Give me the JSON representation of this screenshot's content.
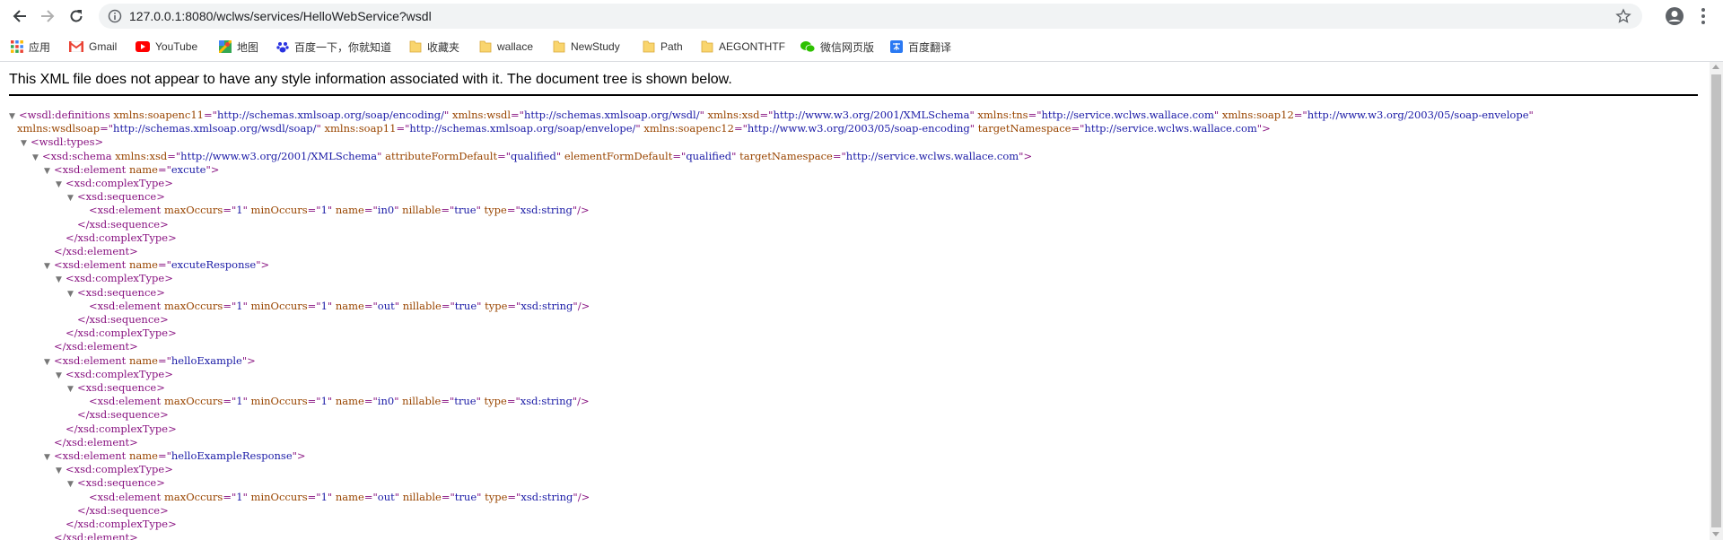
{
  "browser": {
    "url": "127.0.0.1:8080/wclws/services/HelloWebService?wsdl",
    "bookmarks": [
      {
        "label": "应用",
        "icon": "apps-grid-icon"
      },
      {
        "label": "Gmail",
        "icon": "gmail-icon"
      },
      {
        "label": "YouTube",
        "icon": "youtube-icon"
      },
      {
        "label": "地图",
        "icon": "maps-icon"
      },
      {
        "label": "百度一下，你就知道",
        "icon": "baidu-icon"
      },
      {
        "label": "收藏夹",
        "icon": "folder-icon"
      },
      {
        "label": "wallace",
        "icon": "folder-icon"
      },
      {
        "label": "NewStudy",
        "icon": "folder-icon"
      },
      {
        "label": "Path",
        "icon": "folder-icon"
      },
      {
        "label": "AEGONTHTF",
        "icon": "folder-icon"
      },
      {
        "label": "微信网页版",
        "icon": "wechat-icon"
      },
      {
        "label": "百度翻译",
        "icon": "baidu-translate-icon"
      }
    ]
  },
  "notice": "This XML file does not appear to have any style information associated with it. The document tree is shown below.",
  "xml_lines": [
    {
      "indent": 0,
      "toggle": true,
      "parts": [
        [
          "t",
          "<wsdl:definitions "
        ],
        [
          "n",
          "xmlns:soapenc11"
        ],
        [
          "t",
          "=\""
        ],
        [
          "v",
          "http://schemas.xmlsoap.org/soap/encoding/"
        ],
        [
          "t",
          "\" "
        ],
        [
          "n",
          "xmlns:wsdl"
        ],
        [
          "t",
          "=\""
        ],
        [
          "v",
          "http://schemas.xmlsoap.org/wsdl/"
        ],
        [
          "t",
          "\" "
        ],
        [
          "n",
          "xmlns:xsd"
        ],
        [
          "t",
          "=\""
        ],
        [
          "v",
          "http://www.w3.org/2001/XMLSchema"
        ],
        [
          "t",
          "\" "
        ],
        [
          "n",
          "xmlns:tns"
        ],
        [
          "t",
          "=\""
        ],
        [
          "v",
          "http://service.wclws.wallace.com"
        ],
        [
          "t",
          "\" "
        ],
        [
          "n",
          "xmlns:soap12"
        ],
        [
          "t",
          "=\""
        ],
        [
          "v",
          "http://www.w3.org/2003/05/soap-envelope"
        ],
        [
          "t",
          "\""
        ]
      ]
    },
    {
      "indent": 0,
      "toggle": false,
      "cont": true,
      "parts": [
        [
          "n",
          "xmlns:wsdlsoap"
        ],
        [
          "t",
          "=\""
        ],
        [
          "v",
          "http://schemas.xmlsoap.org/wsdl/soap/"
        ],
        [
          "t",
          "\" "
        ],
        [
          "n",
          "xmlns:soap11"
        ],
        [
          "t",
          "=\""
        ],
        [
          "v",
          "http://schemas.xmlsoap.org/soap/envelope/"
        ],
        [
          "t",
          "\" "
        ],
        [
          "n",
          "xmlns:soapenc12"
        ],
        [
          "t",
          "=\""
        ],
        [
          "v",
          "http://www.w3.org/2003/05/soap-encoding"
        ],
        [
          "t",
          "\" "
        ],
        [
          "n",
          "targetNamespace"
        ],
        [
          "t",
          "=\""
        ],
        [
          "v",
          "http://service.wclws.wallace.com"
        ],
        [
          "t",
          "\">"
        ]
      ]
    },
    {
      "indent": 1,
      "toggle": true,
      "parts": [
        [
          "t",
          "<wsdl:types>"
        ]
      ]
    },
    {
      "indent": 2,
      "toggle": true,
      "parts": [
        [
          "t",
          "<xsd:schema "
        ],
        [
          "n",
          "xmlns:xsd"
        ],
        [
          "t",
          "=\""
        ],
        [
          "v",
          "http://www.w3.org/2001/XMLSchema"
        ],
        [
          "t",
          "\" "
        ],
        [
          "n",
          "attributeFormDefault"
        ],
        [
          "t",
          "=\""
        ],
        [
          "v",
          "qualified"
        ],
        [
          "t",
          "\" "
        ],
        [
          "n",
          "elementFormDefault"
        ],
        [
          "t",
          "=\""
        ],
        [
          "v",
          "qualified"
        ],
        [
          "t",
          "\" "
        ],
        [
          "n",
          "targetNamespace"
        ],
        [
          "t",
          "=\""
        ],
        [
          "v",
          "http://service.wclws.wallace.com"
        ],
        [
          "t",
          "\">"
        ]
      ]
    },
    {
      "indent": 3,
      "toggle": true,
      "parts": [
        [
          "t",
          "<xsd:element "
        ],
        [
          "n",
          "name"
        ],
        [
          "t",
          "=\""
        ],
        [
          "v",
          "excute"
        ],
        [
          "t",
          "\">"
        ]
      ]
    },
    {
      "indent": 4,
      "toggle": true,
      "parts": [
        [
          "t",
          "<xsd:complexType>"
        ]
      ]
    },
    {
      "indent": 5,
      "toggle": true,
      "parts": [
        [
          "t",
          "<xsd:sequence>"
        ]
      ]
    },
    {
      "indent": 6,
      "toggle": false,
      "parts": [
        [
          "t",
          "<xsd:element "
        ],
        [
          "n",
          "maxOccurs"
        ],
        [
          "t",
          "=\""
        ],
        [
          "v",
          "1"
        ],
        [
          "t",
          "\" "
        ],
        [
          "n",
          "minOccurs"
        ],
        [
          "t",
          "=\""
        ],
        [
          "v",
          "1"
        ],
        [
          "t",
          "\" "
        ],
        [
          "n",
          "name"
        ],
        [
          "t",
          "=\""
        ],
        [
          "v",
          "in0"
        ],
        [
          "t",
          "\" "
        ],
        [
          "n",
          "nillable"
        ],
        [
          "t",
          "=\""
        ],
        [
          "v",
          "true"
        ],
        [
          "t",
          "\" "
        ],
        [
          "n",
          "type"
        ],
        [
          "t",
          "=\""
        ],
        [
          "v",
          "xsd:string"
        ],
        [
          "t",
          "\"/>"
        ]
      ]
    },
    {
      "indent": 5,
      "toggle": false,
      "parts": [
        [
          "t",
          "</xsd:sequence>"
        ]
      ]
    },
    {
      "indent": 4,
      "toggle": false,
      "parts": [
        [
          "t",
          "</xsd:complexType>"
        ]
      ]
    },
    {
      "indent": 3,
      "toggle": false,
      "parts": [
        [
          "t",
          "</xsd:element>"
        ]
      ]
    },
    {
      "indent": 3,
      "toggle": true,
      "parts": [
        [
          "t",
          "<xsd:element "
        ],
        [
          "n",
          "name"
        ],
        [
          "t",
          "=\""
        ],
        [
          "v",
          "excuteResponse"
        ],
        [
          "t",
          "\">"
        ]
      ]
    },
    {
      "indent": 4,
      "toggle": true,
      "parts": [
        [
          "t",
          "<xsd:complexType>"
        ]
      ]
    },
    {
      "indent": 5,
      "toggle": true,
      "parts": [
        [
          "t",
          "<xsd:sequence>"
        ]
      ]
    },
    {
      "indent": 6,
      "toggle": false,
      "parts": [
        [
          "t",
          "<xsd:element "
        ],
        [
          "n",
          "maxOccurs"
        ],
        [
          "t",
          "=\""
        ],
        [
          "v",
          "1"
        ],
        [
          "t",
          "\" "
        ],
        [
          "n",
          "minOccurs"
        ],
        [
          "t",
          "=\""
        ],
        [
          "v",
          "1"
        ],
        [
          "t",
          "\" "
        ],
        [
          "n",
          "name"
        ],
        [
          "t",
          "=\""
        ],
        [
          "v",
          "out"
        ],
        [
          "t",
          "\" "
        ],
        [
          "n",
          "nillable"
        ],
        [
          "t",
          "=\""
        ],
        [
          "v",
          "true"
        ],
        [
          "t",
          "\" "
        ],
        [
          "n",
          "type"
        ],
        [
          "t",
          "=\""
        ],
        [
          "v",
          "xsd:string"
        ],
        [
          "t",
          "\"/>"
        ]
      ]
    },
    {
      "indent": 5,
      "toggle": false,
      "parts": [
        [
          "t",
          "</xsd:sequence>"
        ]
      ]
    },
    {
      "indent": 4,
      "toggle": false,
      "parts": [
        [
          "t",
          "</xsd:complexType>"
        ]
      ]
    },
    {
      "indent": 3,
      "toggle": false,
      "parts": [
        [
          "t",
          "</xsd:element>"
        ]
      ]
    },
    {
      "indent": 3,
      "toggle": true,
      "parts": [
        [
          "t",
          "<xsd:element "
        ],
        [
          "n",
          "name"
        ],
        [
          "t",
          "=\""
        ],
        [
          "v",
          "helloExample"
        ],
        [
          "t",
          "\">"
        ]
      ]
    },
    {
      "indent": 4,
      "toggle": true,
      "parts": [
        [
          "t",
          "<xsd:complexType>"
        ]
      ]
    },
    {
      "indent": 5,
      "toggle": true,
      "parts": [
        [
          "t",
          "<xsd:sequence>"
        ]
      ]
    },
    {
      "indent": 6,
      "toggle": false,
      "parts": [
        [
          "t",
          "<xsd:element "
        ],
        [
          "n",
          "maxOccurs"
        ],
        [
          "t",
          "=\""
        ],
        [
          "v",
          "1"
        ],
        [
          "t",
          "\" "
        ],
        [
          "n",
          "minOccurs"
        ],
        [
          "t",
          "=\""
        ],
        [
          "v",
          "1"
        ],
        [
          "t",
          "\" "
        ],
        [
          "n",
          "name"
        ],
        [
          "t",
          "=\""
        ],
        [
          "v",
          "in0"
        ],
        [
          "t",
          "\" "
        ],
        [
          "n",
          "nillable"
        ],
        [
          "t",
          "=\""
        ],
        [
          "v",
          "true"
        ],
        [
          "t",
          "\" "
        ],
        [
          "n",
          "type"
        ],
        [
          "t",
          "=\""
        ],
        [
          "v",
          "xsd:string"
        ],
        [
          "t",
          "\"/>"
        ]
      ]
    },
    {
      "indent": 5,
      "toggle": false,
      "parts": [
        [
          "t",
          "</xsd:sequence>"
        ]
      ]
    },
    {
      "indent": 4,
      "toggle": false,
      "parts": [
        [
          "t",
          "</xsd:complexType>"
        ]
      ]
    },
    {
      "indent": 3,
      "toggle": false,
      "parts": [
        [
          "t",
          "</xsd:element>"
        ]
      ]
    },
    {
      "indent": 3,
      "toggle": true,
      "parts": [
        [
          "t",
          "<xsd:element "
        ],
        [
          "n",
          "name"
        ],
        [
          "t",
          "=\""
        ],
        [
          "v",
          "helloExampleResponse"
        ],
        [
          "t",
          "\">"
        ]
      ]
    },
    {
      "indent": 4,
      "toggle": true,
      "parts": [
        [
          "t",
          "<xsd:complexType>"
        ]
      ]
    },
    {
      "indent": 5,
      "toggle": true,
      "parts": [
        [
          "t",
          "<xsd:sequence>"
        ]
      ]
    },
    {
      "indent": 6,
      "toggle": false,
      "parts": [
        [
          "t",
          "<xsd:element "
        ],
        [
          "n",
          "maxOccurs"
        ],
        [
          "t",
          "=\""
        ],
        [
          "v",
          "1"
        ],
        [
          "t",
          "\" "
        ],
        [
          "n",
          "minOccurs"
        ],
        [
          "t",
          "=\""
        ],
        [
          "v",
          "1"
        ],
        [
          "t",
          "\" "
        ],
        [
          "n",
          "name"
        ],
        [
          "t",
          "=\""
        ],
        [
          "v",
          "out"
        ],
        [
          "t",
          "\" "
        ],
        [
          "n",
          "nillable"
        ],
        [
          "t",
          "=\""
        ],
        [
          "v",
          "true"
        ],
        [
          "t",
          "\" "
        ],
        [
          "n",
          "type"
        ],
        [
          "t",
          "=\""
        ],
        [
          "v",
          "xsd:string"
        ],
        [
          "t",
          "\"/>"
        ]
      ]
    },
    {
      "indent": 5,
      "toggle": false,
      "parts": [
        [
          "t",
          "</xsd:sequence>"
        ]
      ]
    },
    {
      "indent": 4,
      "toggle": false,
      "parts": [
        [
          "t",
          "</xsd:complexType>"
        ]
      ]
    },
    {
      "indent": 3,
      "toggle": false,
      "parts": [
        [
          "t",
          "</xsd:element>"
        ]
      ]
    }
  ]
}
